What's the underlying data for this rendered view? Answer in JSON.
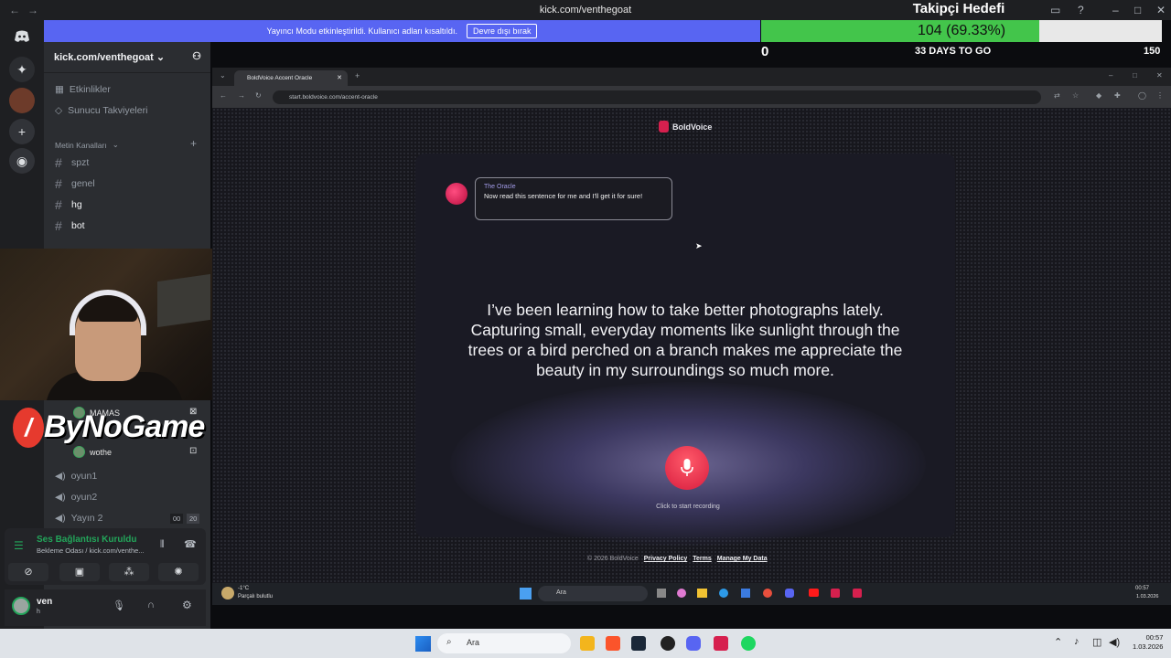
{
  "titlebar": {
    "url": "kick.com/venthegoat"
  },
  "streamer_banner": {
    "text": "Yayıncı Modu etkinleştirildi. Kullanıcı adları kısaltıldı.",
    "button": "Devre dışı bırak"
  },
  "follower_goal": {
    "title": "Takipçi Hedefi",
    "progress_text": "104 (69.33%)",
    "progress": 0.6933,
    "start": "0",
    "days": "33 DAYS TO GO",
    "target": "150"
  },
  "sidebar": {
    "server_name": "kick.com/venthegoat",
    "items": [
      {
        "label": "Etkinlikler"
      },
      {
        "label": "Sunucu Takviyeleri"
      }
    ],
    "category": "Metin Kanalları",
    "channels": [
      {
        "label": "spzt",
        "active": false
      },
      {
        "label": "genel",
        "active": false
      },
      {
        "label": "hg",
        "active": true
      },
      {
        "label": "bot",
        "active": true
      }
    ],
    "voice_users": [
      {
        "label": "MAMAS"
      },
      {
        "label": "wothe"
      }
    ],
    "voice_channels": [
      {
        "label": "oyun1"
      },
      {
        "label": "oyun2"
      },
      {
        "label": "Yayın 2",
        "count_a": "00",
        "count_b": "20"
      }
    ]
  },
  "logo": {
    "text": "ByNoGame"
  },
  "voice_panel": {
    "status": "Ses Bağlantısı Kuruldu",
    "room": "Bekleme Odası / kick.com/venthe..."
  },
  "user_panel": {
    "name": "ven",
    "status": "h"
  },
  "browser": {
    "tab_title": "BoldVoice Accent Oracle",
    "url": "start.boldvoice.com/accent-oracle",
    "brand": "BoldVoice",
    "oracle_name": "The Oracle",
    "oracle_message": "Now read this sentence for me and I'll get it for sure!",
    "sentence": "I’ve been learning how to take better photographs lately. Capturing small, everyday moments like sunlight through the trees or a bird perched on a branch makes me appreciate the beauty in my surroundings so much more.",
    "mic_label": "Click to start recording",
    "footer": {
      "copyright": "© 2026 BoldVoice",
      "privacy": "Privacy Policy",
      "terms": "Terms",
      "manage": "Manage My Data"
    }
  },
  "inner_taskbar": {
    "weather_temp": "-1°C",
    "weather_desc": "Parçalı bulutlu",
    "search": "Ara",
    "time": "00:57",
    "date": "1.03.2026"
  },
  "taskbar": {
    "search": "Ara",
    "time": "00:57",
    "date": "1.03.2026"
  }
}
